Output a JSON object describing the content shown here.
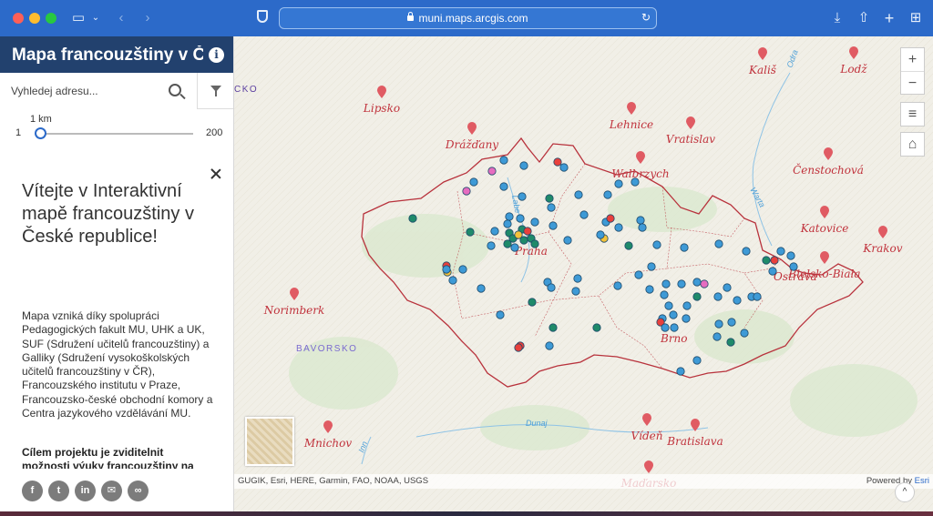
{
  "browser": {
    "url": "muni.maps.arcgis.com",
    "icons": [
      "sidebar-icon",
      "chevron-down-icon",
      "back-icon",
      "forward-icon",
      "shield-icon",
      "lock-icon",
      "reload-icon",
      "download-icon",
      "share-icon",
      "new-tab-icon",
      "tab-overview-icon"
    ]
  },
  "panel": {
    "title": "Mapa francouzštiny v Č",
    "search_placeholder": "Vyhledej adresu...",
    "slider": {
      "value_label": "1 km",
      "min_label": "1",
      "max_label": "200",
      "value": 1,
      "min": 1,
      "max": 200
    },
    "welcome_title": "Vítejte v Interaktivní mapě francouzštiny v České republice!",
    "welcome_body": "Mapa vzniká díky spolupráci Pedagogických fakult MU, UHK a UK, SUF (Sdružení učitelů francouzštiny) a Galliky (Sdružení vysokoškolských učitelů francouzštiny v ČR), Francouzského institutu v Praze, Francouzsko-české obchodní komory a Centra jazykového vzdělávání MU.",
    "welcome_goal": "Cílem projektu je zviditelnit možnosti výuky francouzštiny na",
    "share_buttons": [
      {
        "name": "facebook",
        "glyph": "f"
      },
      {
        "name": "twitter",
        "glyph": "t"
      },
      {
        "name": "linkedin",
        "glyph": "in"
      },
      {
        "name": "email",
        "glyph": "✉"
      },
      {
        "name": "link",
        "glyph": "∞"
      }
    ]
  },
  "map": {
    "cities": [
      {
        "name": "Lipsko"
      },
      {
        "name": "Drážďany"
      },
      {
        "name": "Lehnice"
      },
      {
        "name": "Vratislav"
      },
      {
        "name": "Kališ"
      },
      {
        "name": "Lodž"
      },
      {
        "name": "Walbrzych"
      },
      {
        "name": "Čenstochová"
      },
      {
        "name": "Katovice"
      },
      {
        "name": "Krakov"
      },
      {
        "name": "Bielsko-Biała"
      },
      {
        "name": "Ostrava"
      },
      {
        "name": "Praha"
      },
      {
        "name": "Brno"
      },
      {
        "name": "Norimberk"
      },
      {
        "name": "Mnichov"
      },
      {
        "name": "Vídeň"
      },
      {
        "name": "Bratislava"
      },
      {
        "name": "Maďarsko"
      }
    ],
    "region_labels": [
      "BAVORSKO",
      "CKO"
    ],
    "river_labels": [
      "Dunaj",
      "Odra",
      "Labe",
      "Warta",
      "Inn"
    ],
    "attribution": "GUGIK, Esri, HERE, Garmin, FAO, NOAA, USGS",
    "powered_by": "Powered by",
    "powered_brand": "Esri",
    "controls": {
      "zoom_in": "+",
      "zoom_out": "−",
      "layers": "≡",
      "home": "⌂",
      "scroll_up": "^"
    },
    "colors": {
      "blue": "#3e9ad6",
      "green": "#1f8a6a",
      "red": "#e8403c",
      "pink": "#e66cc0",
      "yellow": "#f3c23a",
      "border": "#b8323c"
    }
  }
}
